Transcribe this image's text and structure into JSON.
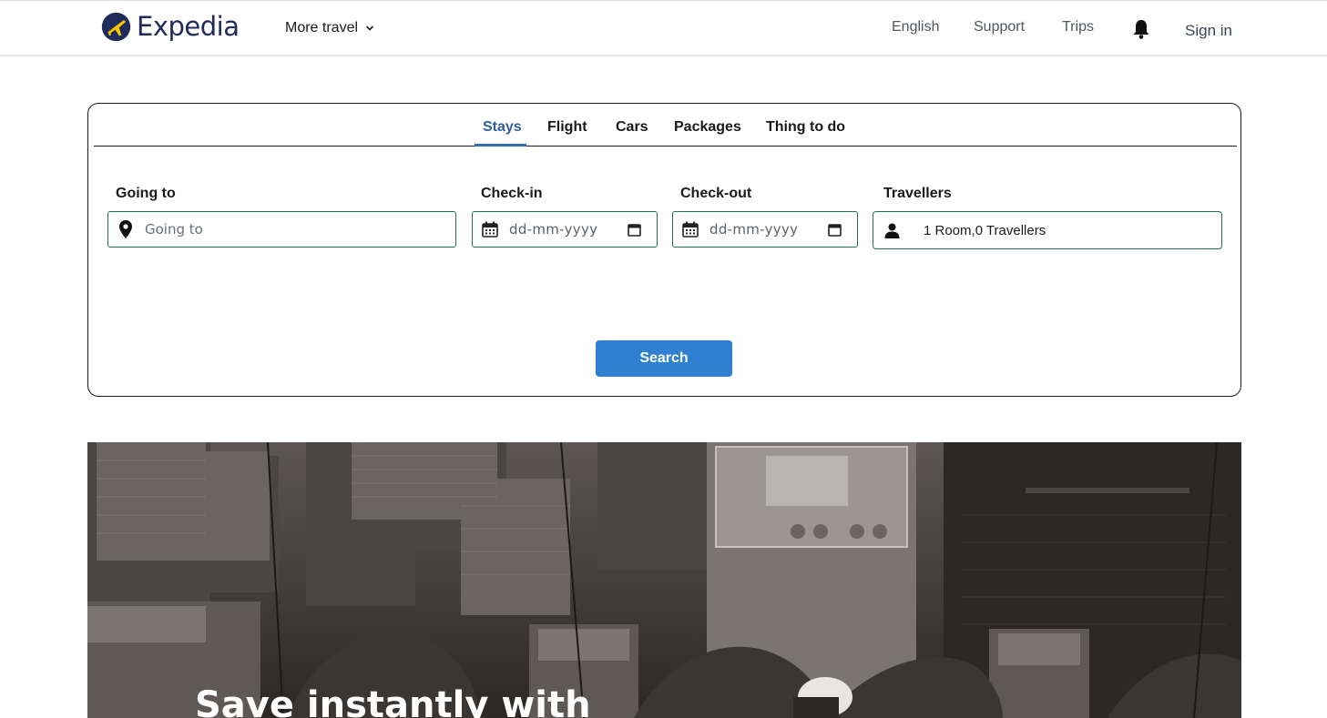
{
  "header": {
    "brand": "Expedia",
    "more_travel": "More travel",
    "links": {
      "language": "English",
      "support": "Support",
      "trips": "Trips",
      "sign_in": "Sign in"
    },
    "icons": [
      "expedia-logo-icon",
      "chevron-down-icon",
      "bell-icon"
    ]
  },
  "search": {
    "tabs": [
      "Stays",
      "Flight",
      "Cars",
      "Packages",
      "Thing to do"
    ],
    "active_tab": "Stays",
    "going_to": {
      "label": "Going to",
      "placeholder": "Going to",
      "icon": "map-pin-icon"
    },
    "check_in": {
      "label": "Check-in",
      "placeholder": "dd-mm-yyyy",
      "icon": "calendar-icon"
    },
    "check_out": {
      "label": "Check-out",
      "placeholder": "dd-mm-yyyy",
      "icon": "calendar-icon"
    },
    "travellers": {
      "label": "Travellers",
      "value": "1 Room,0 Travellers",
      "icon": "person-icon"
    },
    "button": "Search"
  },
  "hero": {
    "title": "Save instantly with"
  },
  "colors": {
    "brand_navy": "#1f2b5b",
    "brand_yellow": "#f7c600",
    "active_tab": "#2e5f9e",
    "button": "#2f80d1",
    "field_border": "#1f6f5c"
  }
}
